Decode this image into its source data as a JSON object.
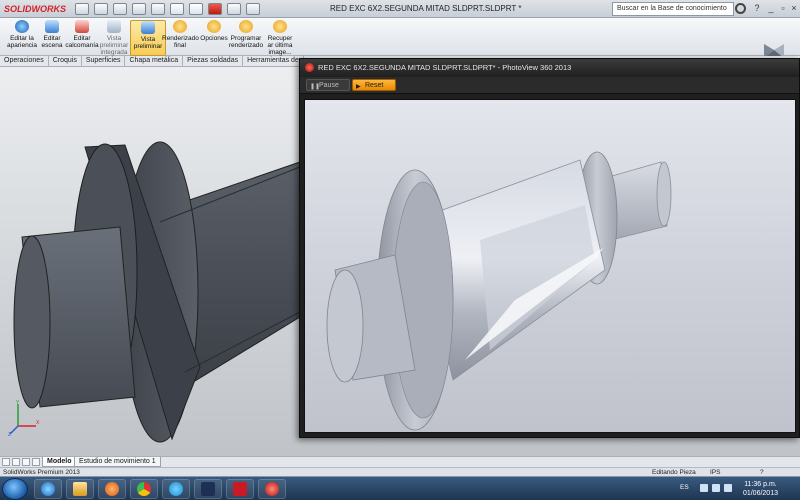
{
  "app": {
    "logo": "SOLIDWORKS",
    "title": "RED EXC 6X2.SEGUNDA MITAD SLDPRT.SLDPRT *"
  },
  "search": {
    "placeholder": "Buscar en la Base de conocimiento"
  },
  "ribbon": {
    "buttons": [
      {
        "label1": "Editar la",
        "label2": "apariencia",
        "color": "#3b7fd1"
      },
      {
        "label1": "Editar",
        "label2": "escena",
        "color": "#6aa8ea"
      },
      {
        "label1": "Editar",
        "label2": "calcomanía",
        "color": "#d1483b"
      },
      {
        "label1": "Vista",
        "label2": "preliminar integrada",
        "color": "#9fb4c8"
      },
      {
        "label1": "Vista",
        "label2": "preliminar",
        "color": "#3b7fd1"
      },
      {
        "label1": "Renderizado",
        "label2": "final",
        "color": "#e7a11c"
      },
      {
        "label1": "Opciones",
        "label2": "",
        "color": "#e7a11c"
      },
      {
        "label1": "Programar",
        "label2": "renderizado",
        "color": "#e7a11c"
      },
      {
        "label1": "Recuper",
        "label2": "ar última image...",
        "color": "#e7a11c"
      }
    ]
  },
  "tabs": [
    "Operaciones",
    "Croquis",
    "Superficies",
    "Chapa metálica",
    "Piezas soldadas",
    "Herramientas de"
  ],
  "bottom_tabs": [
    "Modelo",
    "Estudio de movimiento 1"
  ],
  "status": {
    "product": "SolidWorks Premium 2013",
    "mode": "Editando Pieza",
    "units": "IPS"
  },
  "photoview": {
    "title": "RED EXC 6X2.SEGUNDA MITAD SLDPRT.SLDPRT* - PhotoView 360 2013",
    "pause_label": "Pause",
    "reset_label": "Reset"
  },
  "taskbar": {
    "time": "11:36 p.m.",
    "date": "01/06/2013",
    "lang": "ES"
  },
  "colors": {
    "accent": "#f39c12",
    "brand": "#d2232a"
  }
}
